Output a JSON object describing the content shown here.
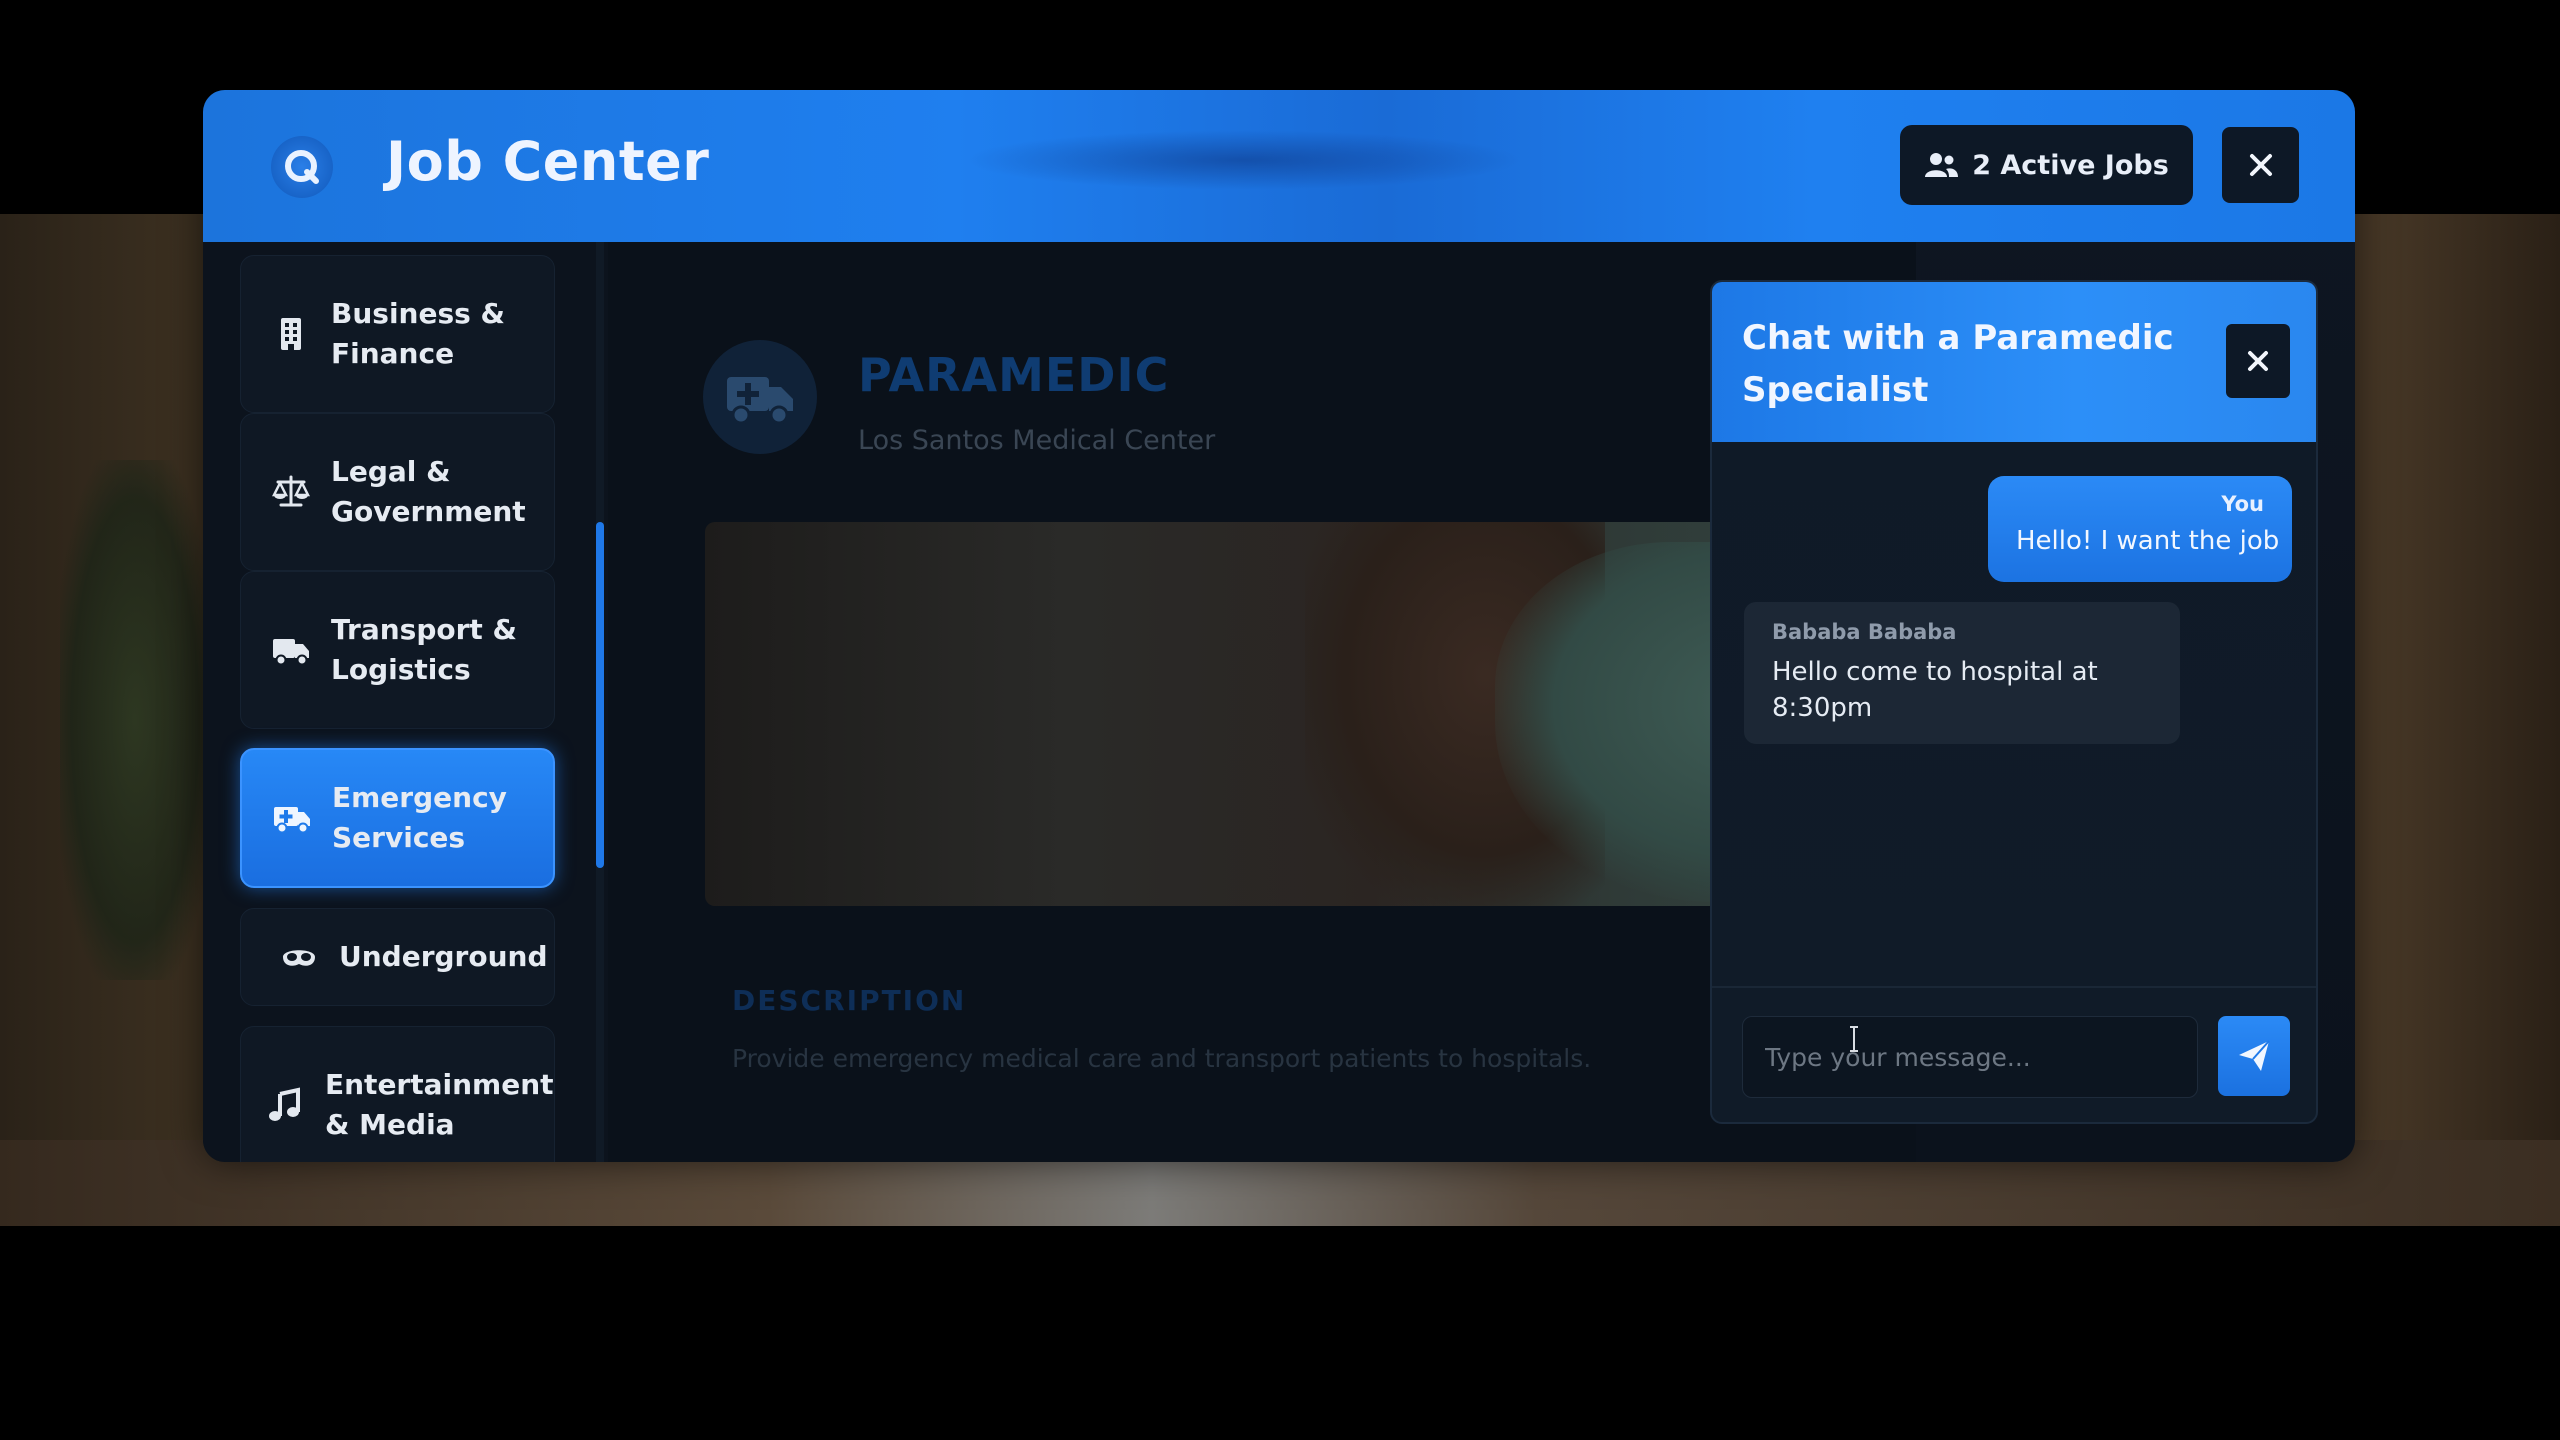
{
  "header": {
    "title": "Job Center",
    "active_jobs_label": "2 Active Jobs"
  },
  "sidebar": {
    "items": [
      {
        "label": "Business & Finance",
        "icon": "building-icon"
      },
      {
        "label": "Legal & Government",
        "icon": "scale-icon"
      },
      {
        "label": "Transport & Logistics",
        "icon": "truck-icon"
      },
      {
        "label": "Emergency Services",
        "icon": "ambulance-icon",
        "active": true
      },
      {
        "label": "Underground",
        "icon": "mask-icon"
      },
      {
        "label": "Entertainment & Media",
        "icon": "music-icon"
      }
    ]
  },
  "job": {
    "title": "PARAMEDIC",
    "company": "Los Santos Medical Center",
    "description_heading": "DESCRIPTION",
    "description": "Provide emergency medical care and transport patients to hospitals."
  },
  "chat": {
    "title": "Chat with a Paramedic Specialist",
    "messages": [
      {
        "sender": "You",
        "text": "Hello! I want the job"
      },
      {
        "sender": "Bababa Bababa",
        "text": "Hello come to hospital at 8:30pm"
      }
    ],
    "input_placeholder": "Type your message..."
  },
  "colors": {
    "accent": "#1f7fef",
    "panel": "#0d1826"
  }
}
